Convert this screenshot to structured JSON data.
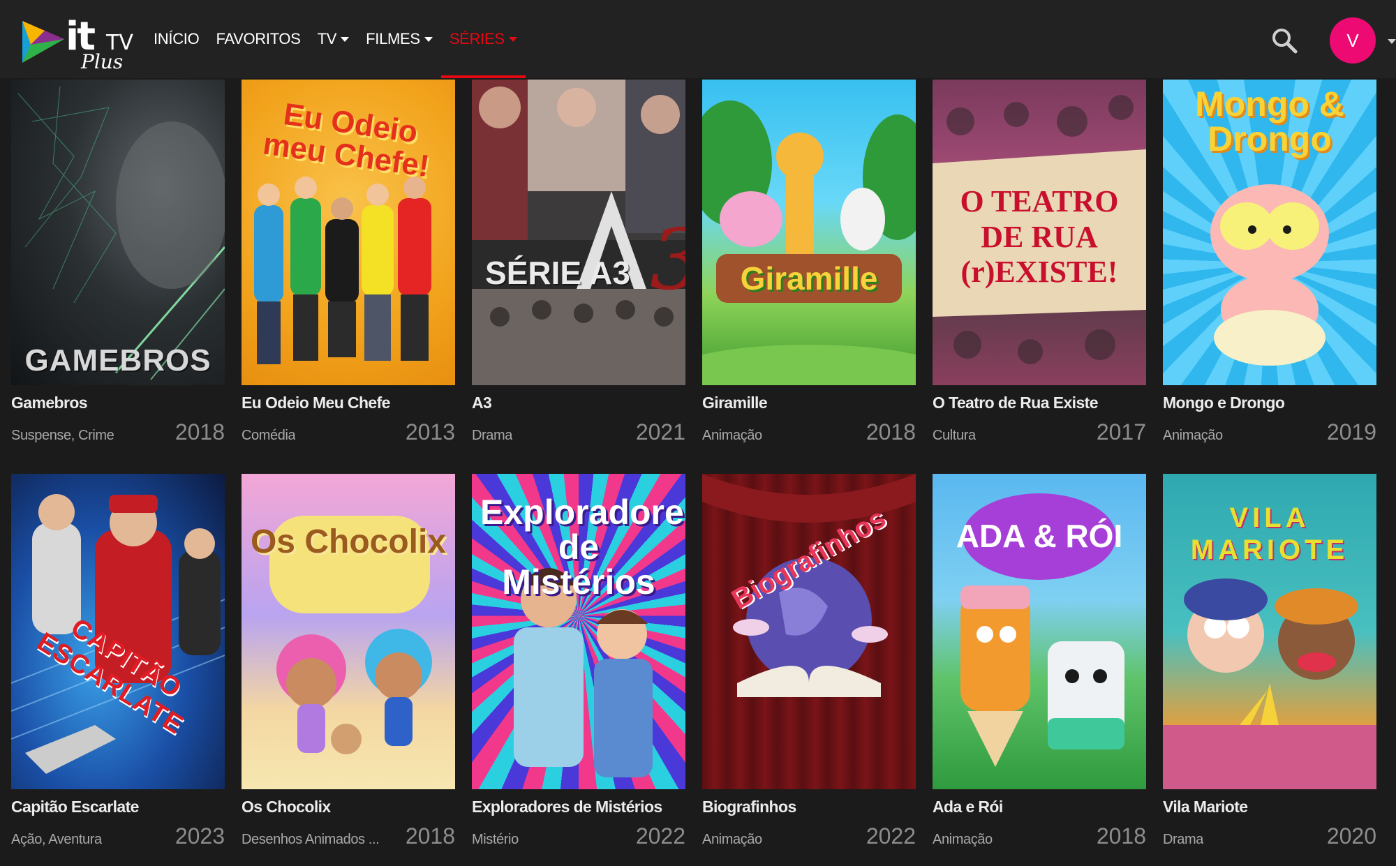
{
  "brand": {
    "logo_it": "it",
    "logo_tv": "TV",
    "logo_plus": "Plus"
  },
  "nav": {
    "items": [
      {
        "label": "INÍCIO"
      },
      {
        "label": "FAVORITOS"
      },
      {
        "label": "TV"
      },
      {
        "label": "FILMES"
      },
      {
        "label": "SÉRIES"
      }
    ]
  },
  "user": {
    "avatar_initial": "V"
  },
  "colors": {
    "accent": "#e50914",
    "avatar": "#ee0a73",
    "background": "#1b1b1b",
    "navbar": "#222222"
  },
  "series": [
    {
      "title": "Gamebros",
      "genre": "Suspense, Crime",
      "year": "2018",
      "poster_text": "GAMEBROS"
    },
    {
      "title": "Eu Odeio Meu Chefe",
      "genre": "Comédia",
      "year": "2013",
      "poster_text": "Eu Odeio meu Chefe!"
    },
    {
      "title": "A3",
      "genre": "Drama",
      "year": "2021",
      "poster_text": "SÉRIE A3"
    },
    {
      "title": "Giramille",
      "genre": "Animação",
      "year": "2018",
      "poster_text": "Giramille"
    },
    {
      "title": "O Teatro de Rua Existe",
      "genre": "Cultura",
      "year": "2017",
      "poster_text": "O TEATRO DE RUA (r)EXISTE!"
    },
    {
      "title": "Mongo e Drongo",
      "genre": "Animação",
      "year": "2019",
      "poster_text": "Mongo & Drongo"
    },
    {
      "title": "Capitão Escarlate",
      "genre": "Ação, Aventura",
      "year": "2023",
      "poster_text": "CAPITÃO ESCARLATE"
    },
    {
      "title": "Os Chocolix",
      "genre": "Desenhos Animados ...",
      "year": "2018",
      "poster_text": "Os Chocolix"
    },
    {
      "title": "Exploradores de Mistérios",
      "genre": "Mistério",
      "year": "2022",
      "poster_text": "Exploradores de Mistérios"
    },
    {
      "title": "Biografinhos",
      "genre": "Animação",
      "year": "2022",
      "poster_text": "Biografinhos"
    },
    {
      "title": "Ada e Rói",
      "genre": "Animação",
      "year": "2018",
      "poster_text": "ADA & RÓI"
    },
    {
      "title": "Vila Mariote",
      "genre": "Drama",
      "year": "2020",
      "poster_text": "VILA MARIOTE"
    }
  ]
}
